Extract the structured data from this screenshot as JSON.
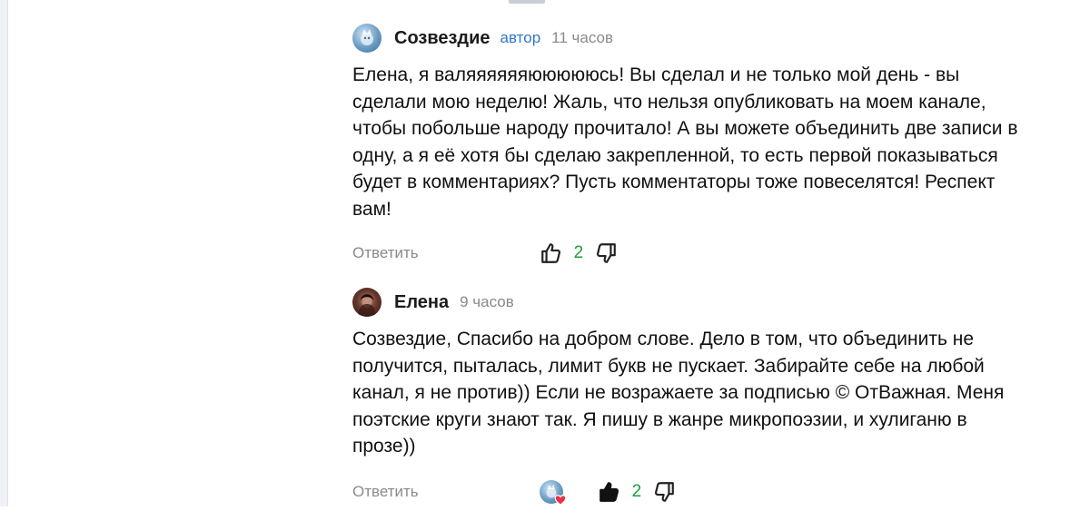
{
  "comments": [
    {
      "author": "Созвездие",
      "badge": "автор",
      "time": "11 часов",
      "text": "Елена, я валяяяяяяюююююсь! Вы сделал и не только мой день - вы\nсделали мою неделю! Жаль, что нельзя опубликовать на моем канале,\nчтобы побольше народу прочитало! А вы можете объединить две записи в\nодну, а я её хотя бы сделаю закрепленной, то есть первой показываться\nбудет в комментариях? Пусть комментаторы тоже повеселятся! Респект\nвам!",
      "reply_label": "Ответить",
      "likes": "2",
      "liked": false
    },
    {
      "author": "Елена",
      "time": "9 часов",
      "text": "Созвездие, Спасибо на добром слове. Дело в том, что объединить не\nполучится, пыталась, лимит букв не пускает. Забирайте себе на любой\nканал, я не против)) Если не возражаете за подписью © ОтВажная. Меня\nпоэтские круги знают так. Я пишу в жанре микропоэзии, и хулиганю в\nпрозе))",
      "reply_label": "Ответить",
      "likes": "2",
      "liked": true,
      "author_liked": true
    }
  ],
  "colors": {
    "accent": "#2f78c4",
    "count": "#1f9d3a",
    "muted": "#8a8a8a",
    "heart": "#e8304a"
  },
  "icons": [
    "thumbs-up-icon",
    "thumbs-down-icon",
    "heart-icon",
    "avatar"
  ]
}
